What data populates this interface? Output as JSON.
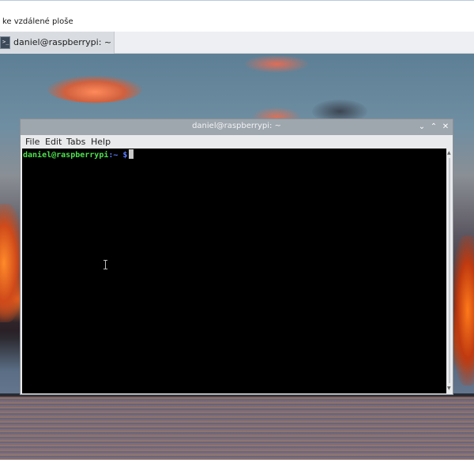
{
  "outer_window": {
    "title": "ke vzdálené ploše"
  },
  "taskbar": {
    "terminal_task_label": "daniel@raspberrypi: ~",
    "terminal_icon_glyph": ">_"
  },
  "terminal": {
    "title": "daniel@raspberrypi: ~",
    "controls": {
      "minimize": "⌄",
      "maximize": "⌃",
      "close": "✕"
    },
    "menu": [
      "File",
      "Edit",
      "Tabs",
      "Help"
    ],
    "prompt": {
      "user_host": "daniel@raspberrypi",
      "path": ":~ $"
    }
  },
  "colors": {
    "prompt_user": "#4fe04f",
    "prompt_path": "#5b7bff",
    "terminal_background": "#000000",
    "titlebar": "#9ea6ae"
  },
  "icons": [
    "terminal-icon",
    "minimize-icon",
    "maximize-icon",
    "close-icon",
    "text-cursor-icon"
  ]
}
